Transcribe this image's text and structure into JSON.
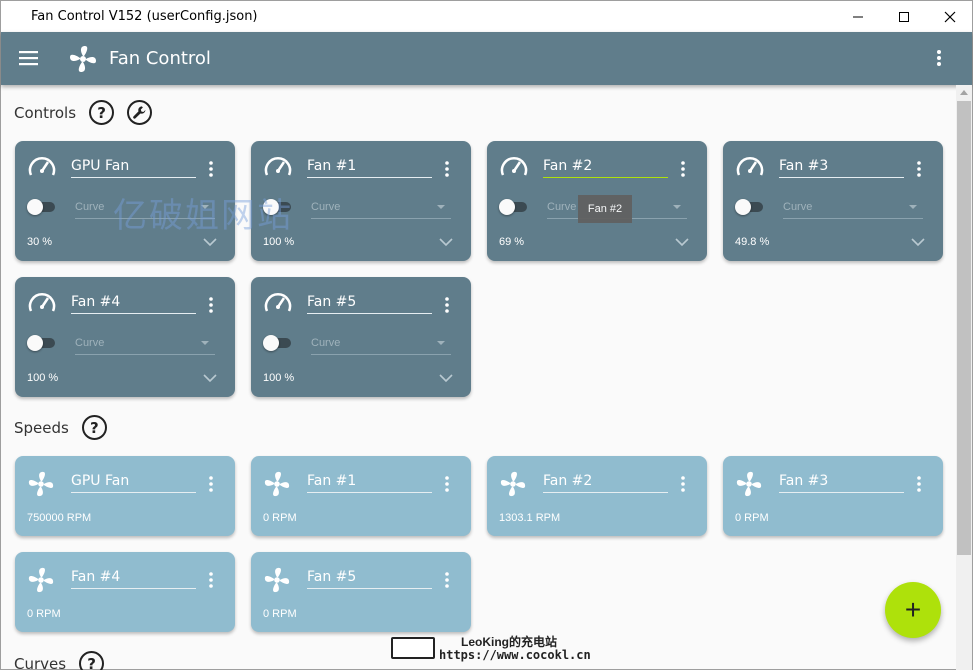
{
  "window": {
    "title": "Fan Control V152 (userConfig.json)"
  },
  "appbar": {
    "title": "Fan Control"
  },
  "sections": {
    "controls": "Controls",
    "speeds": "Speeds",
    "curves": "Curves"
  },
  "controls": [
    {
      "name": "GPU Fan",
      "curve": "Curve",
      "value": "30 %"
    },
    {
      "name": "Fan #1",
      "curve": "Curve",
      "value": "100 %"
    },
    {
      "name": "Fan #2",
      "curve": "Curve",
      "value": "69 %"
    },
    {
      "name": "Fan #3",
      "curve": "Curve",
      "value": "49.8 %"
    },
    {
      "name": "Fan #4",
      "curve": "Curve",
      "value": "100 %"
    },
    {
      "name": "Fan #5",
      "curve": "Curve",
      "value": "100 %"
    }
  ],
  "speeds": [
    {
      "name": "GPU Fan",
      "value": "750000 RPM"
    },
    {
      "name": "Fan #1",
      "value": "0 RPM"
    },
    {
      "name": "Fan #2",
      "value": "1303.1 RPM"
    },
    {
      "name": "Fan #3",
      "value": "0 RPM"
    },
    {
      "name": "Fan #4",
      "value": "0 RPM"
    },
    {
      "name": "Fan #5",
      "value": "0 RPM"
    }
  ],
  "tooltip": "Fan #2",
  "fab": "+",
  "help_glyph": "?",
  "watermark": {
    "cn": "亿破姐网站",
    "line1": "LeoKing的充电站",
    "line2": "https://www.cocokl.cn"
  },
  "colors": {
    "appbar": "#607d8b",
    "control_card": "#607d8b",
    "speed_card": "#90bccf",
    "accent": "#aee10b"
  }
}
